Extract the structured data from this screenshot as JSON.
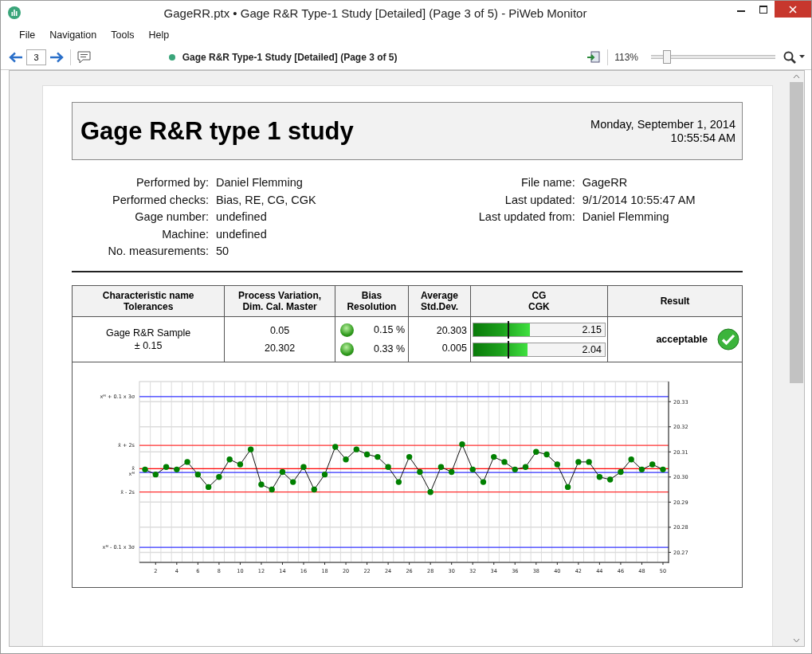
{
  "window": {
    "title": "GageRR.ptx • Gage R&R Type-1 Study [Detailed] (Page 3 of 5) - PiWeb Monitor"
  },
  "menu": [
    "File",
    "Navigation",
    "Tools",
    "Help"
  ],
  "toolbar": {
    "page": "3",
    "document_title": "Gage R&R Type-1 Study [Detailed] (Page 3 of 5)",
    "zoom": "113%",
    "zoom_slider": {
      "level": 0.1
    }
  },
  "report": {
    "title": "Gage R&R type 1 study",
    "date": "Monday, September 1, 2014",
    "time": "10:55:54 AM",
    "info_left": [
      {
        "label": "Performed by:",
        "value": "Daniel Flemming"
      },
      {
        "label": "Performed checks:",
        "value": "Bias, RE, CG, CGK"
      },
      {
        "label": "Gage number:",
        "value": "undefined"
      },
      {
        "label": "Machine:",
        "value": "undefined"
      },
      {
        "label": "No. measurements:",
        "value": "50"
      }
    ],
    "info_right": [
      {
        "label": "File name:",
        "value": "GageRR"
      },
      {
        "label": "Last updated:",
        "value": "9/1/2014 10:55:47 AM"
      },
      {
        "label": "Last updated from:",
        "value": "Daniel Flemming"
      }
    ],
    "table": {
      "columns": [
        [
          "Characteristic name",
          "Tolerances"
        ],
        [
          "Process Variation,",
          "Dim. Cal. Master"
        ],
        [
          "Bias",
          "Resolution"
        ],
        [
          "Average",
          "Std.Dev."
        ],
        [
          "CG",
          "CGK"
        ],
        [
          "Result"
        ]
      ],
      "rows": [
        {
          "name": "Gage R&R Sample",
          "tolerance": "± 0.15",
          "process_variation": "0.05",
          "cal_master": "20.302",
          "bias": {
            "ok": true,
            "value": "0.15 %"
          },
          "resolution": {
            "ok": true,
            "value": "0.33 %"
          },
          "average": "20.303",
          "std_dev": "0.005",
          "cg": {
            "level": 0.43,
            "value": "2.15"
          },
          "cgk": {
            "level": 0.41,
            "value": "2.04"
          },
          "result": "acceptable",
          "result_ok": true
        }
      ]
    },
    "chart_data": {
      "type": "line",
      "x": [
        1,
        2,
        3,
        4,
        5,
        6,
        7,
        8,
        9,
        10,
        11,
        12,
        13,
        14,
        15,
        16,
        17,
        18,
        19,
        20,
        21,
        22,
        23,
        24,
        25,
        26,
        27,
        28,
        29,
        30,
        31,
        32,
        33,
        34,
        35,
        36,
        37,
        38,
        39,
        40,
        41,
        42,
        43,
        44,
        45,
        46,
        47,
        48,
        49,
        50
      ],
      "series": [
        {
          "color": "#008000",
          "marker": "o",
          "values": [
            20.303,
            20.301,
            20.304,
            20.303,
            20.306,
            20.301,
            20.296,
            20.3,
            20.307,
            20.305,
            20.311,
            20.297,
            20.295,
            20.302,
            20.298,
            20.304,
            20.295,
            20.301,
            20.312,
            20.307,
            20.311,
            20.309,
            20.308,
            20.304,
            20.298,
            20.308,
            20.302,
            20.294,
            20.304,
            20.302,
            20.313,
            20.303,
            20.298,
            20.308,
            20.306,
            20.303,
            20.304,
            20.31,
            20.309,
            20.305,
            20.296,
            20.306,
            20.306,
            20.3,
            20.299,
            20.302,
            20.307,
            20.303,
            20.305,
            20.303
          ]
        }
      ],
      "xlim": [
        0.47,
        50.53
      ],
      "ylim": [
        20.266,
        20.338
      ],
      "xticks": [
        2,
        4,
        6,
        8,
        10,
        12,
        14,
        16,
        18,
        20,
        22,
        24,
        26,
        28,
        30,
        32,
        34,
        36,
        38,
        40,
        42,
        44,
        46,
        48,
        50
      ],
      "yticks": [
        {
          "value": 20.27,
          "label": "20.27"
        },
        {
          "value": 20.28,
          "label": "20.28"
        },
        {
          "value": 20.29,
          "label": "20.29"
        },
        {
          "value": 20.3,
          "label": "20.30"
        },
        {
          "value": 20.31,
          "label": "20.31"
        },
        {
          "value": 20.32,
          "label": "20.32"
        },
        {
          "value": 20.33,
          "label": "20.33"
        }
      ],
      "grid": true,
      "ref_lines": [
        {
          "axis": "y",
          "value": 20.332,
          "label": "xᴹ + 0.1 x 3σ",
          "color": "#3333ff"
        },
        {
          "axis": "y",
          "value": 20.3126,
          "label": "x̄ + 2s",
          "color": "#ff3030"
        },
        {
          "axis": "y",
          "value": 20.3033,
          "label": "x̄",
          "color": "#ff0000"
        },
        {
          "axis": "y",
          "value": 20.3018,
          "label": "xᴹ",
          "color": "#3333ff"
        },
        {
          "axis": "y",
          "value": 20.294,
          "label": "x̄ - 2s",
          "color": "#ff3030"
        },
        {
          "axis": "y",
          "value": 20.272,
          "label": "xᴹ - 0.1 x 3σ",
          "color": "#3333ff"
        }
      ]
    }
  }
}
